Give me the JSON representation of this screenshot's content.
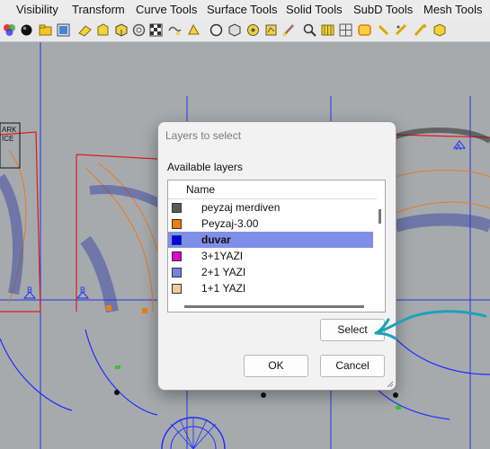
{
  "menu": {
    "items": [
      {
        "label": "Visibility"
      },
      {
        "label": "Transform"
      },
      {
        "label": "Curve Tools"
      },
      {
        "label": "Surface Tools"
      },
      {
        "label": "Solid Tools"
      },
      {
        "label": "SubD Tools"
      },
      {
        "label": "Mesh Tools"
      }
    ]
  },
  "toolbar": {
    "icons": [
      "color-wheel-icon",
      "sphere-icon",
      "folder-icon",
      "display-icon",
      "eraser-icon",
      "shape-icon",
      "cube-icon",
      "cylinder-icon",
      "spiral-icon",
      "checker-icon",
      "circle-icon",
      "render-icon",
      "sphere-wire-icon",
      "box-icon",
      "point-icon",
      "lamp-icon",
      "brush-icon",
      "zoom-icon",
      "grid-icon",
      "mesh-icon",
      "frame-icon",
      "pin-icon",
      "light-icon",
      "key-icon",
      "package-icon"
    ]
  },
  "workspace": {
    "labels": {
      "top_left_1": "ARK",
      "top_left_2": "ICE",
      "marker_b1": "B",
      "marker_b2": "B",
      "marker_a1": "A",
      "marker_a2": "A",
      "marker_b3": "B"
    }
  },
  "dialog": {
    "title": "Layers to select",
    "list_label": "Available layers",
    "column_header": "Name",
    "layers": [
      {
        "name": "peyzaj merdiven",
        "color": "#5a5a5a",
        "selected": false
      },
      {
        "name": "Peyzaj-3.00",
        "color": "#f07d0a",
        "selected": false
      },
      {
        "name": "duvar",
        "color": "#0000ff",
        "selected": true
      },
      {
        "name": "3+1YAZI",
        "color": "#e000d0",
        "selected": false
      },
      {
        "name": "2+1 YAZI",
        "color": "#7b80e0",
        "selected": false
      },
      {
        "name": "1+1 YAZI",
        "color": "#f5c99a",
        "selected": false
      }
    ],
    "select_button": "Select",
    "ok_button": "OK",
    "cancel_button": "Cancel"
  },
  "colors": {
    "annotation": "#1aa3b8",
    "selection": "#7f8fe8",
    "canvas_bg": "#a7aaad",
    "wall_blue": "#1a2fff",
    "landscape_orange": "#e87a1e",
    "boundary_red": "#e01a1a"
  }
}
